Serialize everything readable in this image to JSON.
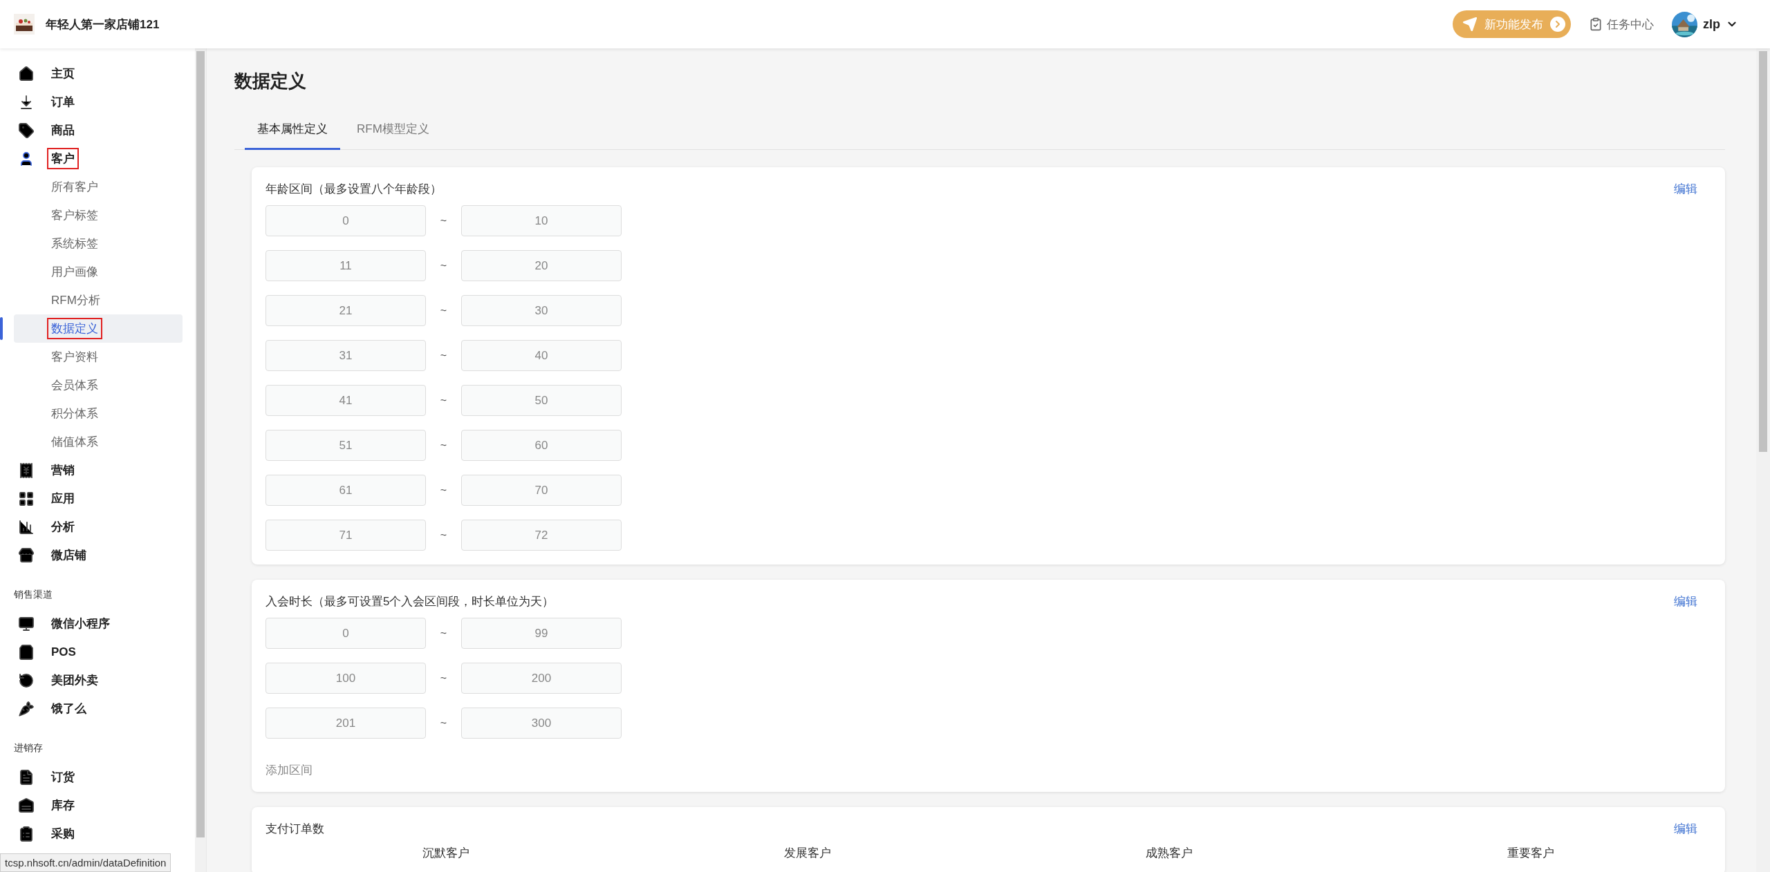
{
  "header": {
    "store_name": "年轻人第一家店铺121",
    "release_button": "新功能发布",
    "task_center": "任务中心",
    "username": "zlp"
  },
  "sidebar": {
    "sections": [
      {
        "items": [
          {
            "label": "主页",
            "selected": false,
            "annotated": false
          },
          {
            "label": "订单",
            "selected": false,
            "annotated": false
          },
          {
            "label": "商品",
            "selected": false,
            "annotated": false
          },
          {
            "label": "客户",
            "selected": true,
            "annotated": true,
            "children": [
              {
                "label": "所有客户",
                "selected": false,
                "annotated": false
              },
              {
                "label": "客户标签",
                "selected": false,
                "annotated": false
              },
              {
                "label": "系统标签",
                "selected": false,
                "annotated": false
              },
              {
                "label": "用户画像",
                "selected": false,
                "annotated": false
              },
              {
                "label": "RFM分析",
                "selected": false,
                "annotated": false
              },
              {
                "label": "数据定义",
                "selected": true,
                "annotated": true
              },
              {
                "label": "客户资料",
                "selected": false,
                "annotated": false
              },
              {
                "label": "会员体系",
                "selected": false,
                "annotated": false
              },
              {
                "label": "积分体系",
                "selected": false,
                "annotated": false
              },
              {
                "label": "储值体系",
                "selected": false,
                "annotated": false
              }
            ]
          },
          {
            "label": "营销",
            "selected": false,
            "annotated": false
          },
          {
            "label": "应用",
            "selected": false,
            "annotated": false
          },
          {
            "label": "分析",
            "selected": false,
            "annotated": false
          },
          {
            "label": "微店铺",
            "selected": false,
            "annotated": false
          }
        ]
      },
      {
        "title": "销售渠道",
        "items": [
          {
            "label": "微信小程序",
            "selected": false,
            "annotated": false
          },
          {
            "label": "POS",
            "selected": false,
            "annotated": false
          },
          {
            "label": "美团外卖",
            "selected": false,
            "annotated": false
          },
          {
            "label": "饿了么",
            "selected": false,
            "annotated": false
          }
        ]
      },
      {
        "title": "进销存",
        "items": [
          {
            "label": "订货",
            "selected": false,
            "annotated": false
          },
          {
            "label": "库存",
            "selected": false,
            "annotated": false
          },
          {
            "label": "采购",
            "selected": false,
            "annotated": false
          }
        ]
      }
    ]
  },
  "status_url": "tcsp.nhsoft.cn/admin/dataDefinition",
  "page": {
    "title": "数据定义",
    "tabs": [
      {
        "label": "基本属性定义",
        "selected": true
      },
      {
        "label": "RFM模型定义",
        "selected": false
      }
    ],
    "cards": [
      {
        "title": "年龄区间（最多设置八个年龄段）",
        "action": "编辑",
        "ranges": [
          {
            "from": "0",
            "sep": "~",
            "to": "10"
          },
          {
            "from": "11",
            "sep": "~",
            "to": "20"
          },
          {
            "from": "21",
            "sep": "~",
            "to": "30"
          },
          {
            "from": "31",
            "sep": "~",
            "to": "40"
          },
          {
            "from": "41",
            "sep": "~",
            "to": "50"
          },
          {
            "from": "51",
            "sep": "~",
            "to": "60"
          },
          {
            "from": "61",
            "sep": "~",
            "to": "70"
          },
          {
            "from": "71",
            "sep": "~",
            "to": "72"
          }
        ]
      },
      {
        "title": "入会时长（最多可设置5个入会区间段，时长单位为天）",
        "action": "编辑",
        "ranges": [
          {
            "from": "0",
            "sep": "~",
            "to": "99"
          },
          {
            "from": "100",
            "sep": "~",
            "to": "200"
          },
          {
            "from": "201",
            "sep": "~",
            "to": "300"
          }
        ],
        "add_link": "添加区间"
      },
      {
        "title": "支付订单数",
        "action": "编辑",
        "columns": [
          "沉默客户",
          "发展客户",
          "成熟客户",
          "重要客户"
        ]
      }
    ]
  }
}
